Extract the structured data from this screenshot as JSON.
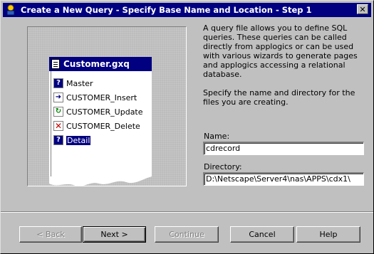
{
  "window": {
    "title": "Create a New Query  - Specify Base Name and Location - Step 1",
    "close_label": "✕"
  },
  "illustration": {
    "file_title": "Customer.gxq",
    "items": [
      {
        "label": "Master",
        "icon": "question-icon",
        "selected": false
      },
      {
        "label": "CUSTOMER_Insert",
        "icon": "insert-arrow-icon",
        "selected": false
      },
      {
        "label": "CUSTOMER_Update",
        "icon": "update-refresh-icon",
        "selected": false
      },
      {
        "label": "CUSTOMER_Delete",
        "icon": "delete-x-icon",
        "selected": false
      },
      {
        "label": "Detail",
        "icon": "question-icon",
        "selected": true
      }
    ]
  },
  "description": {
    "paragraph1": "A query file allows you to define SQL queries. These queries can be called directly from applogics or can be used with various wizards to generate pages and applogics accessing a relational database.",
    "paragraph2": "Specify the name and directory for the files you are creating."
  },
  "form": {
    "name_label": "Name:",
    "name_value": "cdrecord",
    "directory_label": "Directory:",
    "directory_value": "D:\\Netscape\\Server4\\nas\\APPS\\cdx1\\"
  },
  "buttons": {
    "back": "< Back",
    "next": "Next >",
    "continue": "Continue",
    "cancel": "Cancel",
    "help": "Help"
  },
  "colors": {
    "titlebar": "#000080",
    "face": "#c0c0c0",
    "selection": "#000080"
  }
}
